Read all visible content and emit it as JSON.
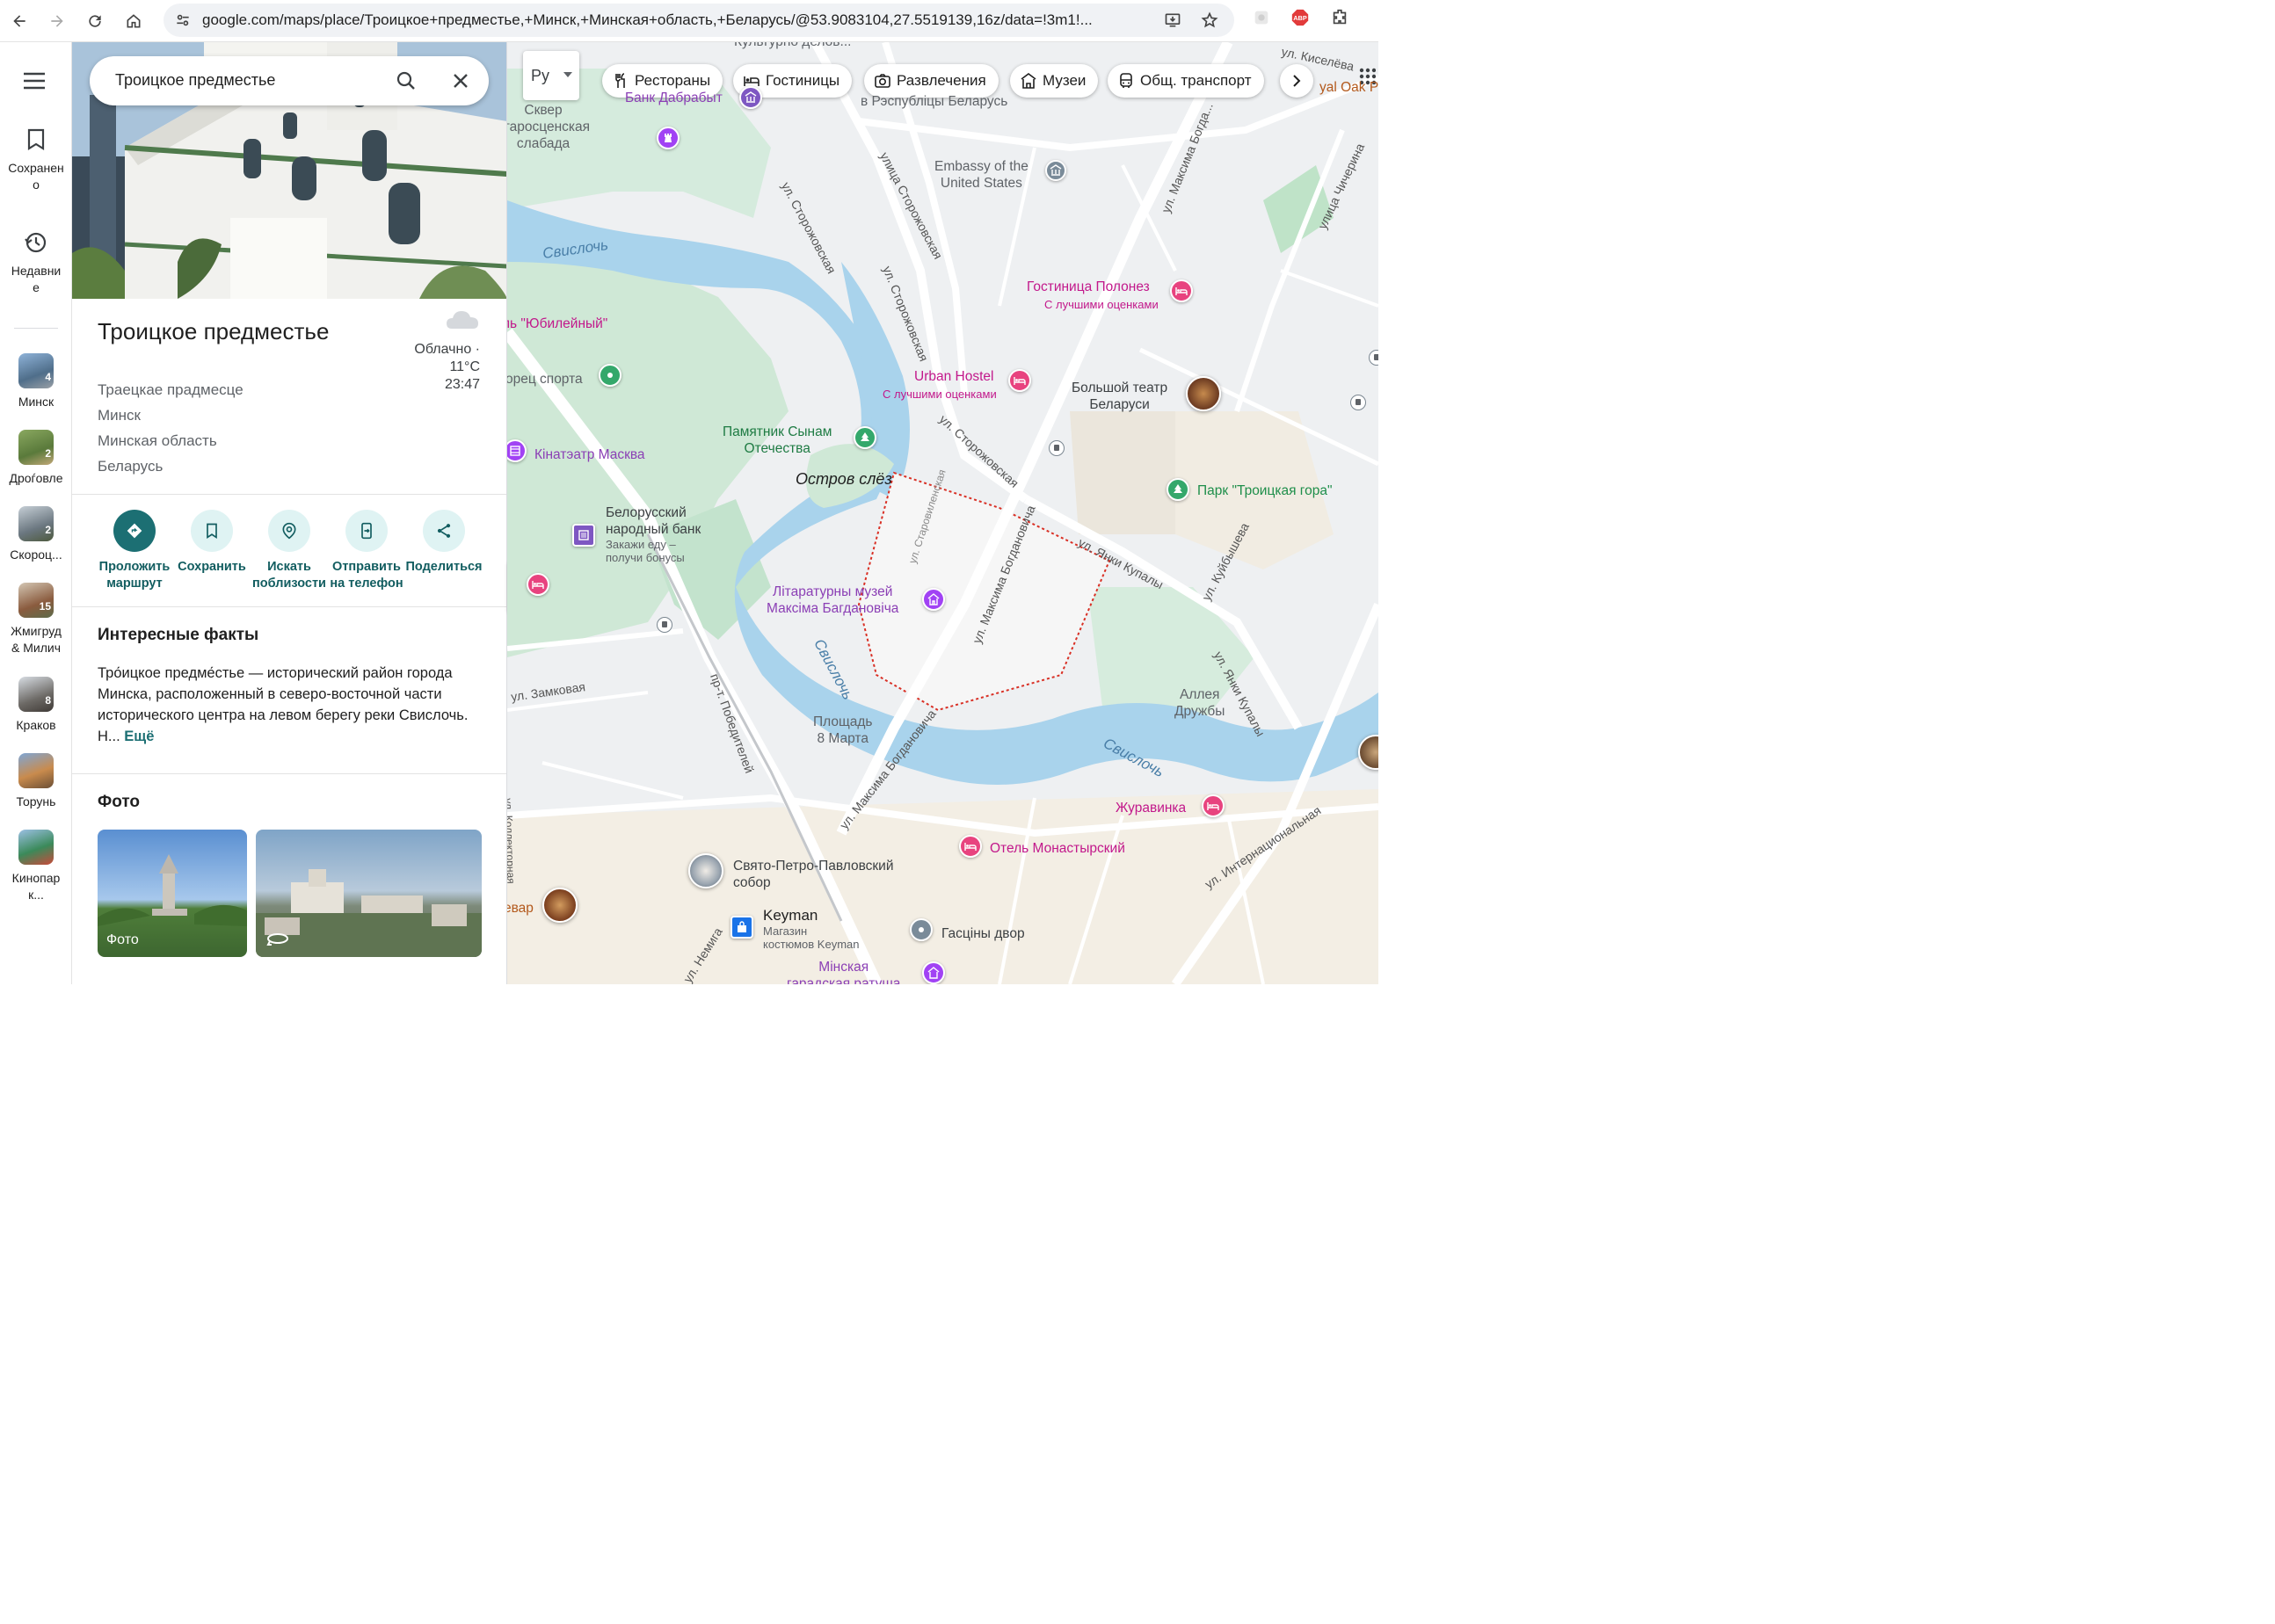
{
  "browser": {
    "url": "google.com/maps/place/Троицкое+предместье,+Минск,+Минская+область,+Беларусь/@53.9083104,27.5519139,16z/data=!3m1!..."
  },
  "rail": {
    "items": [
      {
        "label": "Сохранен\nо",
        "icon": "bookmark-icon"
      },
      {
        "label": "Недавни\nе",
        "icon": "history-icon"
      }
    ],
    "recents": [
      {
        "label": "Минск",
        "count": "4"
      },
      {
        "label": "Дроѓовле",
        "count": "2"
      },
      {
        "label": "Скороц...",
        "count": "2"
      },
      {
        "label": "Жмигруд\n& Милич",
        "count": "15"
      },
      {
        "label": "Краков",
        "count": "8"
      },
      {
        "label": "Торунь",
        "count": ""
      },
      {
        "label": "Кинопар\nк...",
        "count": ""
      }
    ]
  },
  "search": {
    "query": "Троицкое предместье"
  },
  "place": {
    "title": "Троицкое предместье",
    "address_lines": [
      "Траецкае прадмесце",
      "Минск",
      "Минская область",
      "Беларусь"
    ],
    "weather": {
      "condition": "Облачно ·",
      "temp": "11°C",
      "time": "23:47"
    }
  },
  "actions": [
    {
      "label": "Проложить маршрут",
      "icon": "directions-icon"
    },
    {
      "label": "Сохранить",
      "icon": "bookmark-icon"
    },
    {
      "label": "Искать поблизости",
      "icon": "nearby-icon"
    },
    {
      "label": "Отправить на телефон",
      "icon": "send-to-phone-icon"
    },
    {
      "label": "Поделиться",
      "icon": "share-icon"
    }
  ],
  "facts": {
    "heading": "Интересные факты",
    "text": "Тро́ицкое предме́стье — исторический район города Минска, расположенный в северо-восточной части исторического центра на левом берегу реки Свислочь. Н...",
    "more": "Ещё"
  },
  "photos": {
    "heading": "Фото",
    "items": [
      {
        "caption": "Фото"
      },
      {
        "caption": ""
      }
    ]
  },
  "map": {
    "language_button": "Ру",
    "chips": [
      {
        "label": "Рестораны",
        "icon": "fork-knife-icon"
      },
      {
        "label": "Гостиницы",
        "icon": "bed-icon"
      },
      {
        "label": "Развлечения",
        "icon": "camera-icon"
      },
      {
        "label": "Музеи",
        "icon": "museum-icon"
      },
      {
        "label": "Общ. транспорт",
        "icon": "bus-icon"
      }
    ],
    "labels": {
      "kulturnye": "Культурно делов...",
      "kiseleva": "ул. Киселёва",
      "royal_oak": "yal Oak Pu",
      "bank": "Банк Дабрабыт",
      "respublica": "в Рэспубліцы Беларусь",
      "skver": "Сквер\nстаросценская\nслабада",
      "embassy": "Embassy of the\nUnited States",
      "svisloch1": "Свислочь",
      "storozh1": "ул. Сторожовская",
      "storozh2": "улица Сторожовская",
      "storozh3": "ул. Сторожовская",
      "storozh4": "ул. Сторожовская",
      "bogd_top": "ул. Максима Богда...",
      "chicherina": "улица Чичерина",
      "polonez": "Гостиница Полонез",
      "polonez_sub": "С лучшими оценками",
      "yubileiny": "ль \"Юбилейный\"",
      "dvorets": "орец спорта",
      "urban": "Urban Hostel",
      "urban_sub": "С лучшими оценками",
      "bolshoi": "Большой театр\nБеларуси",
      "pamyatnik": "Памятник Сынам\nОтечества",
      "kinoteatr": "Кінатэатр Масква",
      "ostrov": "Остров слёз",
      "starovil": "ул. Старовиленская",
      "bogd_mid": "ул. Максима Богдановича",
      "park": "Парк \"Троицкая гора\"",
      "nbrb": "Белорусский\nнародный банк",
      "nbrb_sub": "Закажи еду –\nполучи бонусы",
      "kupaly1": "ул. Янки Купалы",
      "kuibysheva": "ул. Куйбышева",
      "muzei": "Літаратурны музей\nМаксіма Багдановіча",
      "bogd_low": "ул. Максима Богдановича",
      "svisloch2": "Свислочь",
      "kupaly2": "ул. Янки Купалы",
      "alleya": "Аллея\nДружбы",
      "zamkovaya": "ул. Замковая",
      "pobed": "пр-т. Победителей",
      "ploshad": "Площадь\n8 Марта",
      "svisloch3": "Свислочь",
      "bogd_bot": "ул. Максима Богдановича",
      "zhuravinka": "Журавинка",
      "internats": "ул. Интернациональная",
      "monast": "Отель Монастырский",
      "sobor": "Свято-Петро-Павловский\nсобор",
      "kominterna": "ул. Немига",
      "var": "евар",
      "keyman": "Keyman",
      "keyman_sub": "Магазин\nкостюмов Keyman",
      "gostiny": "Гасціны двор",
      "ratusha": "Мінская\nгарадская ратуша",
      "kolleg": "ул. Коллекторная"
    }
  }
}
